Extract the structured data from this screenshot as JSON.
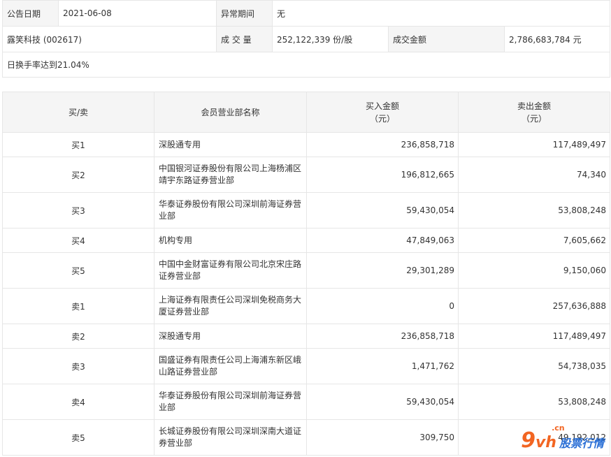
{
  "info": {
    "announce_date_label": "公告日期",
    "announce_date": "2021-06-08",
    "anomaly_period_label": "异常期间",
    "anomaly_period": "无",
    "stock": "露笑科技 (002617)",
    "volume_label": "成 交 量",
    "volume": "252,122,339 份/股",
    "amount_label": "成交金额",
    "amount": "2,786,683,784 元",
    "note": "日换手率达到21.04%"
  },
  "table": {
    "headers": {
      "side": "买/卖",
      "dept": "会员营业部名称",
      "buy_line1": "买入金额",
      "buy_line2": "（元）",
      "sell_line1": "卖出金额",
      "sell_line2": "（元）"
    },
    "rows": [
      {
        "side": "买1",
        "dept": "深股通专用",
        "buy": "236,858,718",
        "sell": "117,489,497"
      },
      {
        "side": "买2",
        "dept": "中国银河证券股份有限公司上海杨浦区靖宇东路证券营业部",
        "buy": "196,812,665",
        "sell": "74,340"
      },
      {
        "side": "买3",
        "dept": "华泰证券股份有限公司深圳前海证券营业部",
        "buy": "59,430,054",
        "sell": "53,808,248"
      },
      {
        "side": "买4",
        "dept": "机构专用",
        "buy": "47,849,063",
        "sell": "7,605,662"
      },
      {
        "side": "买5",
        "dept": "中国中金财富证券有限公司北京宋庄路证券营业部",
        "buy": "29,301,289",
        "sell": "9,150,060"
      },
      {
        "side": "卖1",
        "dept": "上海证券有限责任公司深圳免税商务大厦证券营业部",
        "buy": "0",
        "sell": "257,636,888"
      },
      {
        "side": "卖2",
        "dept": "深股通专用",
        "buy": "236,858,718",
        "sell": "117,489,497"
      },
      {
        "side": "卖3",
        "dept": "国盛证券有限责任公司上海浦东新区峨山路证券营业部",
        "buy": "1,471,762",
        "sell": "54,738,035"
      },
      {
        "side": "卖4",
        "dept": "华泰证券股份有限公司深圳前海证券营业部",
        "buy": "59,430,054",
        "sell": "53,808,248"
      },
      {
        "side": "卖5",
        "dept": "长城证券股份有限公司深圳深南大道证券营业部",
        "buy": "309,750",
        "sell": "49,192,012"
      }
    ]
  },
  "watermark": {
    "brand_num": "9",
    "brand_letters": "vh",
    "brand_domain": ".cn",
    "brand_text": "股票行情"
  }
}
